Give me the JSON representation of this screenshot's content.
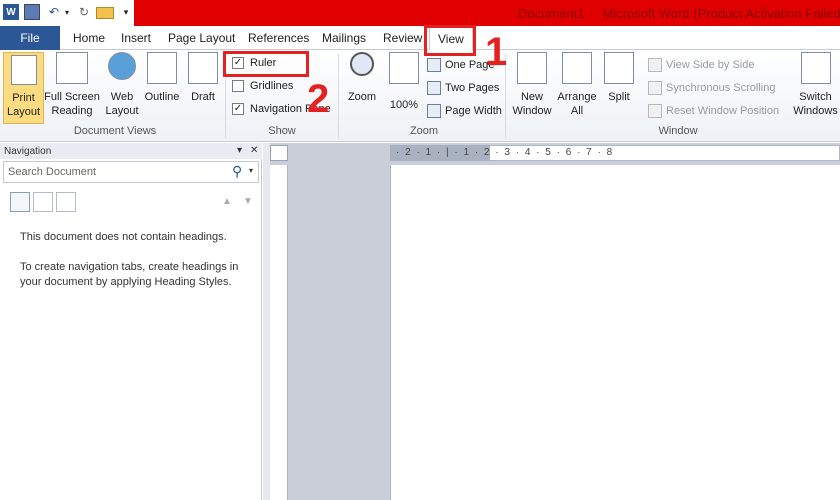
{
  "title_bar": {
    "document": "Document1",
    "app": "Microsoft Word (Product Activation Failed)"
  },
  "tabs": {
    "file": "File",
    "home": "Home",
    "insert": "Insert",
    "page_layout": "Page Layout",
    "references": "References",
    "mailings": "Mailings",
    "review": "Review",
    "view": "View"
  },
  "document_views": {
    "print_layout": [
      "Print",
      "Layout"
    ],
    "full_screen": [
      "Full Screen",
      "Reading"
    ],
    "web_layout": [
      "Web",
      "Layout"
    ],
    "outline": "Outline",
    "draft": "Draft",
    "group_label": "Document Views"
  },
  "show": {
    "ruler": "Ruler",
    "gridlines": "Gridlines",
    "navigation_pane": "Navigation Pane",
    "group_label": "Show"
  },
  "zoom": {
    "zoom": "Zoom",
    "hundred": "100%",
    "one_page": "One Page",
    "two_pages": "Two Pages",
    "page_width": "Page Width",
    "group_label": "Zoom"
  },
  "window": {
    "new_window": [
      "New",
      "Window"
    ],
    "arrange_all": [
      "Arrange",
      "All"
    ],
    "split": "Split",
    "view_side_by_side": "View Side by Side",
    "sync_scrolling": "Synchronous Scrolling",
    "reset_position": "Reset Window Position",
    "switch_windows": [
      "Switch",
      "Windows"
    ],
    "group_label": "Window"
  },
  "annotations": {
    "step1": "1",
    "step2": "2"
  },
  "navigation": {
    "title": "Navigation",
    "search_placeholder": "Search Document",
    "msg1": "This document does not contain headings.",
    "msg2": "To create navigation tabs, create headings in your document by applying Heading Styles."
  },
  "ruler_labels": "· 2 · 1 · | · 1 · 2 · 3 · 4 · 5 · 6 · 7 · 8",
  "colors": {
    "title_red": "#e00000",
    "file_blue": "#2b5797",
    "highlight": "#fddb80",
    "annotation_red": "#e52020"
  }
}
